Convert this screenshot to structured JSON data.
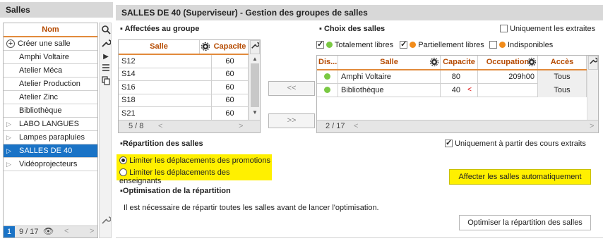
{
  "left_panel": {
    "title": "Salles",
    "column_header": "Nom",
    "create_label": "Créer une salle",
    "items": [
      {
        "label": "Amphi Voltaire",
        "group": false,
        "selected": false
      },
      {
        "label": "Atelier Méca",
        "group": false,
        "selected": false
      },
      {
        "label": "Atelier Production",
        "group": false,
        "selected": false
      },
      {
        "label": "Atelier Zinc",
        "group": false,
        "selected": false
      },
      {
        "label": "Bibliothèque",
        "group": false,
        "selected": false
      },
      {
        "label": "LABO LANGUES",
        "group": true,
        "selected": false
      },
      {
        "label": "Lampes parapluies",
        "group": true,
        "selected": false
      },
      {
        "label": "SALLES DE 40",
        "group": true,
        "selected": true
      },
      {
        "label": "Vidéoprojecteurs",
        "group": true,
        "selected": false
      }
    ],
    "footer": {
      "selected_count": "1",
      "total": "9 / 17"
    }
  },
  "main": {
    "title": "SALLES DE 40 (Superviseur) - Gestion des groupes de salles",
    "affected": {
      "title": "Affectées au groupe",
      "headers": {
        "salle": "Salle",
        "capacite": "Capacite"
      },
      "rows": [
        {
          "salle": "S12",
          "capacite": "60"
        },
        {
          "salle": "S14",
          "capacite": "60"
        },
        {
          "salle": "S16",
          "capacite": "60"
        },
        {
          "salle": "S18",
          "capacite": "60"
        },
        {
          "salle": "S21",
          "capacite": "60"
        }
      ],
      "footer": "5 / 8"
    },
    "move_left_label": "<<",
    "move_right_label": ">>",
    "choice": {
      "title": "Choix des salles",
      "only_extracted": "Uniquement les extraites",
      "filters": {
        "totally_free": "Totalement libres",
        "partially_free": "Partiellement libres",
        "unavailable": "Indisponibles"
      },
      "headers": {
        "dis": "Dis...",
        "salle": "Salle",
        "capacite": "Capacite",
        "occupation": "Occupation",
        "acces": "Accès"
      },
      "rows": [
        {
          "salle": "Amphi Voltaire",
          "capacite": "80",
          "flag": "",
          "occupation": "209h00",
          "acces": "Tous"
        },
        {
          "salle": "Bibliothèque",
          "capacite": "40",
          "flag": "<",
          "occupation": "",
          "acces": "Tous"
        }
      ],
      "footer": "2 / 17"
    },
    "repartition": {
      "title": "Répartition des salles",
      "only_extracted_courses": "Uniquement à partir des cours extraits",
      "option_promotions": "Limiter les déplacements des promotions",
      "option_teachers": "Limiter les déplacements des enseignants",
      "auto_button": "Affecter les salles automatiquement"
    },
    "optimisation": {
      "title": "Optimisation de la répartition",
      "info": "Il est nécessaire de répartir toutes les salles avant de lancer l'optimisation.",
      "button": "Optimiser la répartition des salles"
    }
  },
  "colors": {
    "free": "#7ac943",
    "partial": "#f28c1a",
    "selected": "#1a73c6",
    "highlight": "#fff000",
    "header_text": "#b54a00"
  }
}
